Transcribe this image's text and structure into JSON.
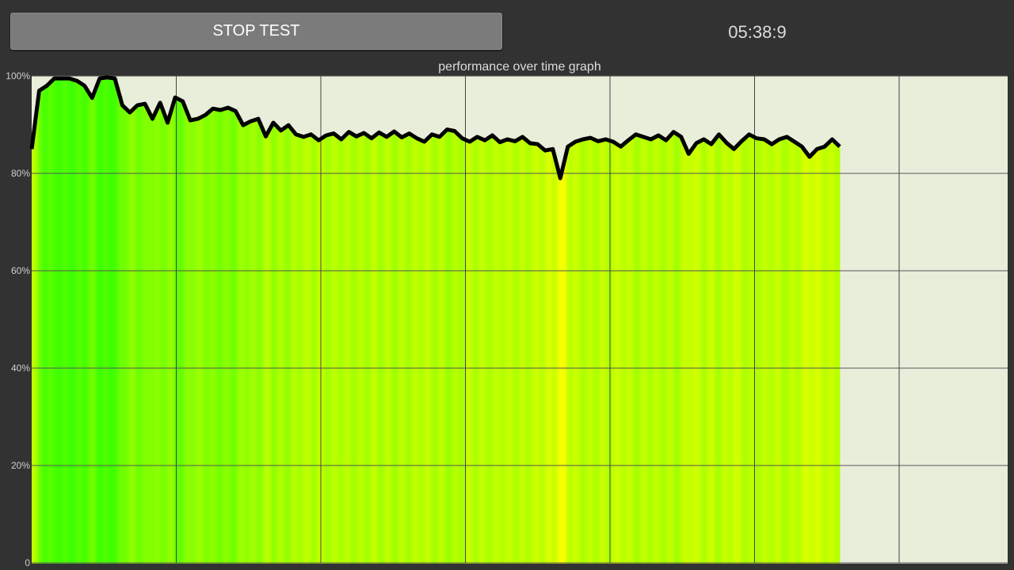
{
  "header": {
    "stop_button_label": "STOP TEST",
    "timer": "05:38:9"
  },
  "chart_data": {
    "type": "area",
    "title": "performance over time graph",
    "ylabel": "",
    "xlabel": "",
    "ylim": [
      0,
      100
    ],
    "y_ticks": [
      "0",
      "20%",
      "40%",
      "60%",
      "80%",
      "100%"
    ],
    "grid": true,
    "colors": {
      "background": "#e9eedb",
      "line": "#000000",
      "fill_high": "#33ff00",
      "fill_low": "#ddff00"
    },
    "values": [
      85,
      97,
      98,
      99.5,
      99.5,
      99.5,
      99,
      98,
      95.5,
      99.5,
      99.7,
      99.5,
      94,
      92.5,
      94,
      94.3,
      91.2,
      94.5,
      90.4,
      95.6,
      94.8,
      90.9,
      91.2,
      92,
      93.3,
      93,
      93.5,
      92.8,
      89.9,
      90.7,
      91.2,
      87.6,
      90.4,
      88.8,
      89.9,
      88,
      87.5,
      88,
      86.8,
      87.8,
      88.2,
      87,
      88.5,
      87.6,
      88.3,
      87.2,
      88.4,
      87.5,
      88.6,
      87.4,
      88.2,
      87.2,
      86.5,
      88,
      87.5,
      89,
      88.7,
      87.2,
      86.5,
      87.5,
      86.8,
      87.8,
      86.4,
      87,
      86.6,
      87.5,
      86.2,
      86,
      84.7,
      85,
      79,
      85.5,
      86.5,
      87,
      87.3,
      86.6,
      87,
      86.5,
      85.5,
      86.8,
      88,
      87.5,
      87,
      87.8,
      86.8,
      88.5,
      87.5,
      84,
      86.2,
      87,
      86,
      88,
      86.3,
      85,
      86.6,
      88,
      87.2,
      87,
      86,
      87,
      87.5,
      86.5,
      85.5,
      83.4,
      85,
      85.5,
      87,
      85.5
    ]
  }
}
